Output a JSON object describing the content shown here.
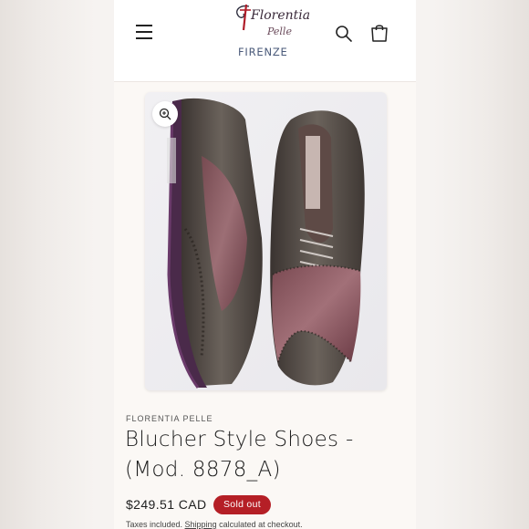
{
  "header": {
    "menu_icon": "hamburger-menu-icon",
    "logo": {
      "line1": "Florentia",
      "line2": "Pelle",
      "city": "FIRENZE"
    },
    "search_icon": "search-icon",
    "cart_icon": "shopping-bag-icon"
  },
  "media": {
    "zoom_icon": "zoom-in-icon",
    "image_subject": "pair of brown and burgundy wingtip brogue shoes"
  },
  "product": {
    "vendor": "FLORENTIA PELLE",
    "title": "Blucher Style Shoes - (Mod. 8878_A)",
    "price": "$249.51 CAD",
    "badge": "Sold out",
    "tax_prefix": "Taxes included. ",
    "shipping_link": "Shipping",
    "tax_suffix": " calculated at checkout."
  },
  "colors": {
    "badge_bg": "#b51f26",
    "logo_red": "#b01e2a",
    "text": "#1e1e1e"
  }
}
